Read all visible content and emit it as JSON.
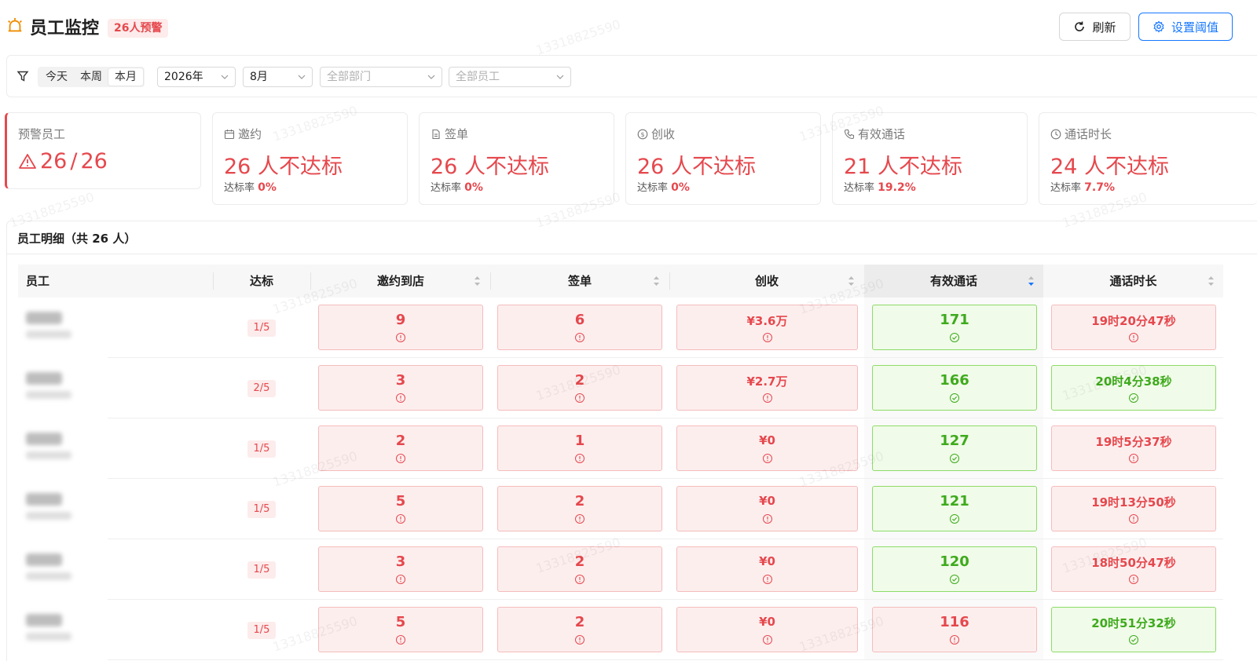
{
  "header": {
    "title": "员工监控",
    "warning_tag": "26人预警",
    "refresh_label": "刷新",
    "threshold_label": "设置阈值"
  },
  "filters": {
    "range_options": [
      "今天",
      "本周",
      "本月"
    ],
    "active_range": "本月",
    "year": "2026年",
    "month": "8月",
    "department_placeholder": "全部部门",
    "employee_placeholder": "全部员工"
  },
  "stats": {
    "warning": {
      "label": "预警员工",
      "current": "26",
      "separator": "/",
      "total": "26"
    },
    "invite": {
      "label": "邀约",
      "value": "26 人不达标",
      "rate_label": "达标率",
      "rate": "0%"
    },
    "sign": {
      "label": "签单",
      "value": "26 人不达标",
      "rate_label": "达标率",
      "rate": "0%"
    },
    "revenue": {
      "label": "创收",
      "value": "26 人不达标",
      "rate_label": "达标率",
      "rate": "0%"
    },
    "calls": {
      "label": "有效通话",
      "value": "21 人不达标",
      "rate_label": "达标率",
      "rate": "19.2%"
    },
    "duration": {
      "label": "通话时长",
      "value": "24 人不达标",
      "rate_label": "达标率",
      "rate": "7.7%"
    }
  },
  "table": {
    "title": "员工明细（共 26 人）",
    "columns": {
      "employee": "员工",
      "pass": "达标",
      "invite": "邀约到店",
      "sign": "签单",
      "revenue": "创收",
      "calls": "有效通话",
      "duration": "通话时长"
    },
    "sorted_column": "calls",
    "rows": [
      {
        "pass": "1/5",
        "invite": "9",
        "sign": "6",
        "revenue": "¥3.6万",
        "calls": "171",
        "duration": "19时20分47秒",
        "ok": {
          "invite": false,
          "sign": false,
          "revenue": false,
          "calls": true,
          "duration": false
        }
      },
      {
        "pass": "2/5",
        "invite": "3",
        "sign": "2",
        "revenue": "¥2.7万",
        "calls": "166",
        "duration": "20时4分38秒",
        "ok": {
          "invite": false,
          "sign": false,
          "revenue": false,
          "calls": true,
          "duration": true
        }
      },
      {
        "pass": "1/5",
        "invite": "2",
        "sign": "1",
        "revenue": "¥0",
        "calls": "127",
        "duration": "19时5分37秒",
        "ok": {
          "invite": false,
          "sign": false,
          "revenue": false,
          "calls": true,
          "duration": false
        }
      },
      {
        "pass": "1/5",
        "invite": "5",
        "sign": "2",
        "revenue": "¥0",
        "calls": "121",
        "duration": "19时13分50秒",
        "ok": {
          "invite": false,
          "sign": false,
          "revenue": false,
          "calls": true,
          "duration": false
        }
      },
      {
        "pass": "1/5",
        "invite": "3",
        "sign": "2",
        "revenue": "¥0",
        "calls": "120",
        "duration": "18时50分47秒",
        "ok": {
          "invite": false,
          "sign": false,
          "revenue": false,
          "calls": true,
          "duration": false
        }
      },
      {
        "pass": "1/5",
        "invite": "5",
        "sign": "2",
        "revenue": "¥0",
        "calls": "116",
        "duration": "20时51分32秒",
        "ok": {
          "invite": false,
          "sign": false,
          "revenue": false,
          "calls": false,
          "duration": true
        }
      }
    ]
  },
  "watermark": "13318825590",
  "colors": {
    "danger": "#e5484d",
    "success": "#3eaa1c",
    "primary": "#1677ff",
    "accent": "#f08c00"
  },
  "icons": [
    "bell-icon",
    "refresh-icon",
    "gear-icon",
    "filter-icon",
    "warning-triangle-icon",
    "calendar-icon",
    "document-icon",
    "dollar-icon",
    "phone-icon",
    "clock-icon",
    "sort-icon",
    "alert-circle-icon",
    "check-circle-icon"
  ]
}
